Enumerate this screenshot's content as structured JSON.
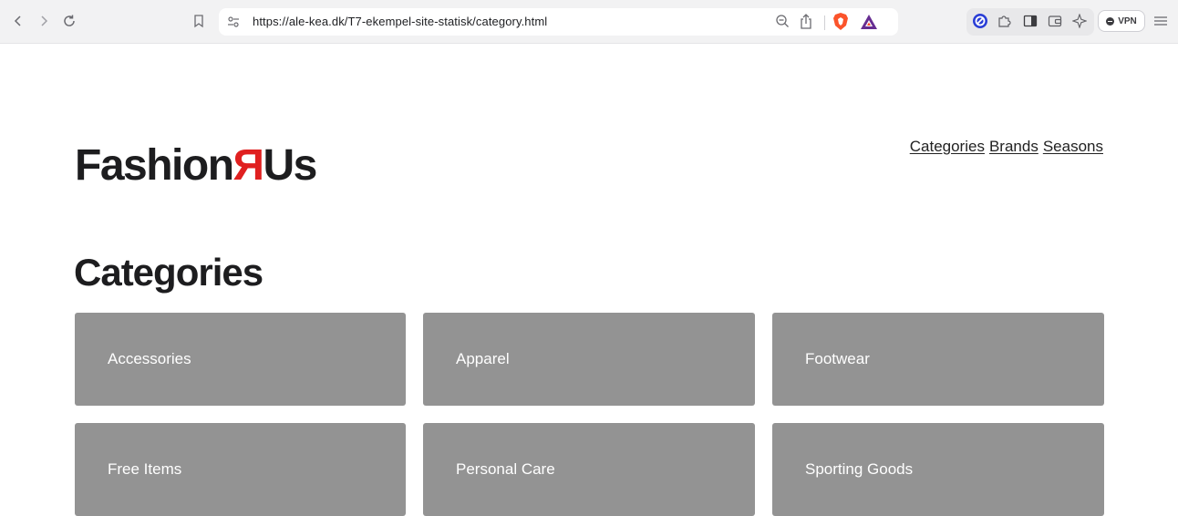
{
  "browser": {
    "url": "https://ale-kea.dk/T7-ekempel-site-statisk/category.html",
    "vpn_label": "VPN",
    "colors": {
      "toolbar": "#f2f2f3",
      "brave_orange": "#fb542b",
      "bat_purple": "#662d91"
    }
  },
  "header": {
    "logo_prefix": "Fashion",
    "logo_r": "Я",
    "logo_suffix": "Us",
    "logo_accent": "#e02020",
    "nav": [
      "Categories",
      "Brands",
      "Seasons"
    ]
  },
  "main": {
    "title": "Categories",
    "cards": [
      "Accessories",
      "Apparel",
      "Footwear",
      "Free Items",
      "Personal Care",
      "Sporting Goods"
    ],
    "card_color": "#939393"
  },
  "icons": [
    "back-icon",
    "forward-icon",
    "reload-icon",
    "bookmark-icon",
    "site-settings-icon",
    "zoom-out-icon",
    "share-icon",
    "brave-shields-icon",
    "bat-rewards-icon",
    "extension-blue-icon",
    "puzzle-icon",
    "sidebar-icon",
    "wallet-icon",
    "leo-icon",
    "menu-icon"
  ]
}
